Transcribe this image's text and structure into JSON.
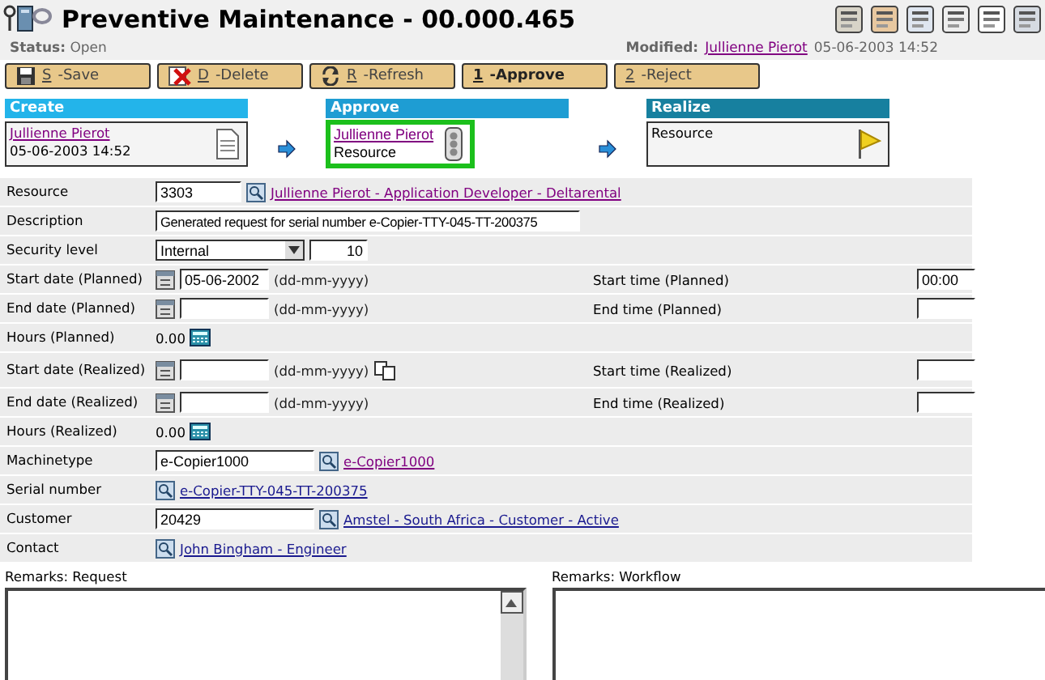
{
  "title": "Preventive Maintenance - 00.000.465",
  "status": {
    "label": "Status:",
    "value": "Open"
  },
  "modified": {
    "label": "Modified:",
    "user": "Jullienne Pierot",
    "date": "05-06-2003 14:52"
  },
  "buttons": [
    {
      "kind": "save",
      "key": "S",
      "label": "-Save",
      "bold": false
    },
    {
      "kind": "delete",
      "key": "D",
      "label": "-Delete",
      "bold": false
    },
    {
      "kind": "refresh",
      "key": "R",
      "label": "-Refresh",
      "bold": false
    },
    {
      "kind": "plain",
      "key": "1",
      "label": "-Approve",
      "bold": true
    },
    {
      "kind": "plain",
      "key": "2",
      "label": "-Reject",
      "bold": false
    }
  ],
  "workflow": [
    {
      "name": "Create",
      "selected": false,
      "link": "Jullienne Pierot",
      "text": "05-06-2003 14:52"
    },
    {
      "name": "Approve",
      "selected": true,
      "link": "Jullienne Pierot",
      "text": "Resource"
    },
    {
      "name": "Realize",
      "selected": false,
      "text": "Resource"
    }
  ],
  "rows": [
    {
      "kind": "lookup",
      "label": "Resource",
      "value": "3303",
      "link": "Jullienne Pierot - Application Developer - Deltarental",
      "visited": true
    },
    {
      "kind": "text",
      "label": "Description",
      "value": "Generated request for serial number e-Copier-TTY-045-TT-200375"
    },
    {
      "kind": "select",
      "label": "Security level",
      "value": "Internal",
      "extra": "10"
    },
    {
      "kind": "date",
      "label": "Start date (Planned)",
      "value": "05-06-2002",
      "hint": "(dd-mm-yyyy)",
      "right_label": "Start time (Planned)",
      "right_value": "00:00"
    },
    {
      "kind": "date",
      "label": "End date (Planned)",
      "hint": "(dd-mm-yyyy)",
      "right_label": "End time (Planned)"
    },
    {
      "kind": "hours",
      "label": "Hours (Planned)",
      "value": "0.00"
    },
    {
      "kind": "date",
      "label": "Start date (Realized)",
      "hint": "(dd-mm-yyyy)",
      "copy": true,
      "right_label": "Start time (Realized)"
    },
    {
      "kind": "date",
      "label": "End date (Realized)",
      "hint": "(dd-mm-yyyy)",
      "right_label": "End time (Realized)"
    },
    {
      "kind": "hours",
      "label": "Hours (Realized)",
      "value": "0.00"
    },
    {
      "kind": "lookup",
      "label": "Machinetype",
      "value": "e-Copier1000",
      "link": "e-Copier1000",
      "visited": true
    },
    {
      "kind": "link",
      "label": "Serial number",
      "link": "e-Copier-TTY-045-TT-200375",
      "visited": false
    },
    {
      "kind": "lookup",
      "label": "Customer",
      "value": "20429",
      "link": "Amstel - South Africa - Customer - Active",
      "visited": false
    },
    {
      "kind": "link",
      "label": "Contact",
      "link": "John Bingham - Engineer",
      "visited": false
    }
  ],
  "remarks": [
    {
      "label": "Remarks: Request",
      "scrollbar": true
    },
    {
      "label": "Remarks: Workflow",
      "scrollbar": false
    }
  ]
}
